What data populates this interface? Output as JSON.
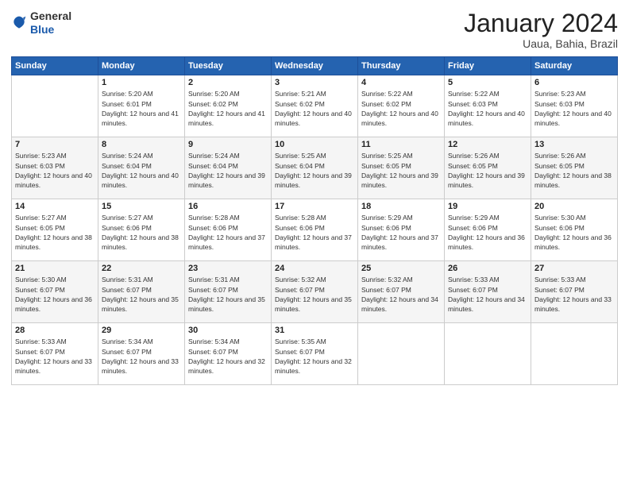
{
  "logo": {
    "general": "General",
    "blue": "Blue"
  },
  "header": {
    "title": "January 2024",
    "subtitle": "Uaua, Bahia, Brazil"
  },
  "weekdays": [
    "Sunday",
    "Monday",
    "Tuesday",
    "Wednesday",
    "Thursday",
    "Friday",
    "Saturday"
  ],
  "weeks": [
    [
      {
        "day": "",
        "sunrise": "",
        "sunset": "",
        "daylight": ""
      },
      {
        "day": "1",
        "sunrise": "5:20 AM",
        "sunset": "6:01 PM",
        "daylight": "12 hours and 41 minutes."
      },
      {
        "day": "2",
        "sunrise": "5:20 AM",
        "sunset": "6:02 PM",
        "daylight": "12 hours and 41 minutes."
      },
      {
        "day": "3",
        "sunrise": "5:21 AM",
        "sunset": "6:02 PM",
        "daylight": "12 hours and 40 minutes."
      },
      {
        "day": "4",
        "sunrise": "5:22 AM",
        "sunset": "6:02 PM",
        "daylight": "12 hours and 40 minutes."
      },
      {
        "day": "5",
        "sunrise": "5:22 AM",
        "sunset": "6:03 PM",
        "daylight": "12 hours and 40 minutes."
      },
      {
        "day": "6",
        "sunrise": "5:23 AM",
        "sunset": "6:03 PM",
        "daylight": "12 hours and 40 minutes."
      }
    ],
    [
      {
        "day": "7",
        "sunrise": "5:23 AM",
        "sunset": "6:03 PM",
        "daylight": "12 hours and 40 minutes."
      },
      {
        "day": "8",
        "sunrise": "5:24 AM",
        "sunset": "6:04 PM",
        "daylight": "12 hours and 40 minutes."
      },
      {
        "day": "9",
        "sunrise": "5:24 AM",
        "sunset": "6:04 PM",
        "daylight": "12 hours and 39 minutes."
      },
      {
        "day": "10",
        "sunrise": "5:25 AM",
        "sunset": "6:04 PM",
        "daylight": "12 hours and 39 minutes."
      },
      {
        "day": "11",
        "sunrise": "5:25 AM",
        "sunset": "6:05 PM",
        "daylight": "12 hours and 39 minutes."
      },
      {
        "day": "12",
        "sunrise": "5:26 AM",
        "sunset": "6:05 PM",
        "daylight": "12 hours and 39 minutes."
      },
      {
        "day": "13",
        "sunrise": "5:26 AM",
        "sunset": "6:05 PM",
        "daylight": "12 hours and 38 minutes."
      }
    ],
    [
      {
        "day": "14",
        "sunrise": "5:27 AM",
        "sunset": "6:05 PM",
        "daylight": "12 hours and 38 minutes."
      },
      {
        "day": "15",
        "sunrise": "5:27 AM",
        "sunset": "6:06 PM",
        "daylight": "12 hours and 38 minutes."
      },
      {
        "day": "16",
        "sunrise": "5:28 AM",
        "sunset": "6:06 PM",
        "daylight": "12 hours and 37 minutes."
      },
      {
        "day": "17",
        "sunrise": "5:28 AM",
        "sunset": "6:06 PM",
        "daylight": "12 hours and 37 minutes."
      },
      {
        "day": "18",
        "sunrise": "5:29 AM",
        "sunset": "6:06 PM",
        "daylight": "12 hours and 37 minutes."
      },
      {
        "day": "19",
        "sunrise": "5:29 AM",
        "sunset": "6:06 PM",
        "daylight": "12 hours and 36 minutes."
      },
      {
        "day": "20",
        "sunrise": "5:30 AM",
        "sunset": "6:06 PM",
        "daylight": "12 hours and 36 minutes."
      }
    ],
    [
      {
        "day": "21",
        "sunrise": "5:30 AM",
        "sunset": "6:07 PM",
        "daylight": "12 hours and 36 minutes."
      },
      {
        "day": "22",
        "sunrise": "5:31 AM",
        "sunset": "6:07 PM",
        "daylight": "12 hours and 35 minutes."
      },
      {
        "day": "23",
        "sunrise": "5:31 AM",
        "sunset": "6:07 PM",
        "daylight": "12 hours and 35 minutes."
      },
      {
        "day": "24",
        "sunrise": "5:32 AM",
        "sunset": "6:07 PM",
        "daylight": "12 hours and 35 minutes."
      },
      {
        "day": "25",
        "sunrise": "5:32 AM",
        "sunset": "6:07 PM",
        "daylight": "12 hours and 34 minutes."
      },
      {
        "day": "26",
        "sunrise": "5:33 AM",
        "sunset": "6:07 PM",
        "daylight": "12 hours and 34 minutes."
      },
      {
        "day": "27",
        "sunrise": "5:33 AM",
        "sunset": "6:07 PM",
        "daylight": "12 hours and 33 minutes."
      }
    ],
    [
      {
        "day": "28",
        "sunrise": "5:33 AM",
        "sunset": "6:07 PM",
        "daylight": "12 hours and 33 minutes."
      },
      {
        "day": "29",
        "sunrise": "5:34 AM",
        "sunset": "6:07 PM",
        "daylight": "12 hours and 33 minutes."
      },
      {
        "day": "30",
        "sunrise": "5:34 AM",
        "sunset": "6:07 PM",
        "daylight": "12 hours and 32 minutes."
      },
      {
        "day": "31",
        "sunrise": "5:35 AM",
        "sunset": "6:07 PM",
        "daylight": "12 hours and 32 minutes."
      },
      {
        "day": "",
        "sunrise": "",
        "sunset": "",
        "daylight": ""
      },
      {
        "day": "",
        "sunrise": "",
        "sunset": "",
        "daylight": ""
      },
      {
        "day": "",
        "sunrise": "",
        "sunset": "",
        "daylight": ""
      }
    ]
  ],
  "labels": {
    "sunrise": "Sunrise:",
    "sunset": "Sunset:",
    "daylight": "Daylight:"
  }
}
